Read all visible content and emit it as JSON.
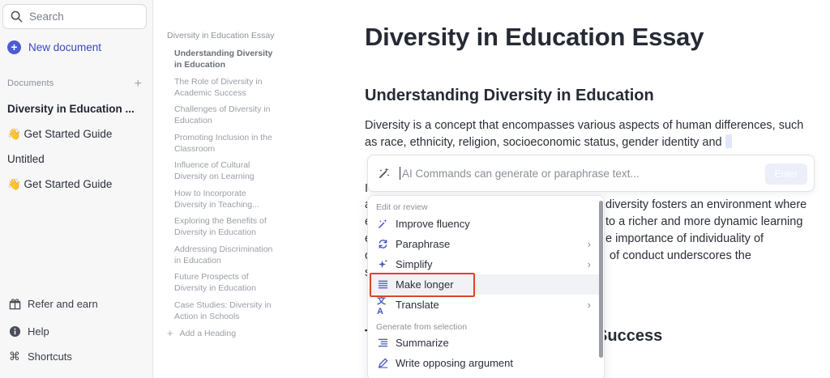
{
  "sidebar": {
    "search_placeholder": "Search",
    "new_document": "New document",
    "documents_header": "Documents",
    "documents": [
      {
        "label": "Diversity in Education ..."
      },
      {
        "label": "👋 Get Started Guide"
      },
      {
        "label": "Untitled"
      },
      {
        "label": "👋 Get Started Guide"
      }
    ],
    "bottom": {
      "refer": "Refer and earn",
      "help": "Help",
      "shortcuts": "Shortcuts"
    }
  },
  "outline": {
    "title": "Diversity in Education Essay",
    "items": [
      "Understanding Diversity in Education",
      "The Role of Diversity in Academic Success",
      "Challenges of Diversity in Education",
      "Promoting Inclusion in the Classroom",
      "Influence of Cultural Diversity on Learning",
      "How to Incorporate Diversity in Teaching...",
      "Exploring the Benefits of Diversity in Education",
      "Addressing Discrimination in Education",
      "Future Prospects of Diversity in Education",
      "Case Studies: Diversity in Action in Schools"
    ],
    "add_heading": "Add a Heading"
  },
  "document": {
    "title": "Diversity in Education Essay",
    "heading1": "Understanding Diversity in Education",
    "paragraph": "Diversity is a concept that encompasses various aspects of human differences, such as race, ethnicity, religion, socioeconomic status, gender identity and",
    "bg_lines": [
      "I",
      "a",
      "diversity fosters an environment where",
      "e",
      "to a richer and more dynamic learning",
      "e",
      "e importance of individuality of",
      "c",
      "of conduct underscores the",
      "s"
    ],
    "heading2_start": "T",
    "heading2_tail": "mic Success"
  },
  "ai_bar": {
    "placeholder": "AI Commands can generate or paraphrase text...",
    "enter": "Enter"
  },
  "menu": {
    "section1": "Edit or review",
    "section2": "Generate from selection",
    "items": [
      {
        "label": "Improve fluency",
        "icon": "sparkle-icon"
      },
      {
        "label": "Paraphrase",
        "icon": "refresh-icon"
      },
      {
        "label": "Simplify",
        "icon": "stars-icon"
      },
      {
        "label": "Make longer",
        "icon": "lines-icon"
      },
      {
        "label": "Translate",
        "icon": "translate-icon"
      },
      {
        "label": "Summarize",
        "icon": "list-icon"
      },
      {
        "label": "Write opposing argument",
        "icon": "pencil-icon"
      }
    ]
  }
}
